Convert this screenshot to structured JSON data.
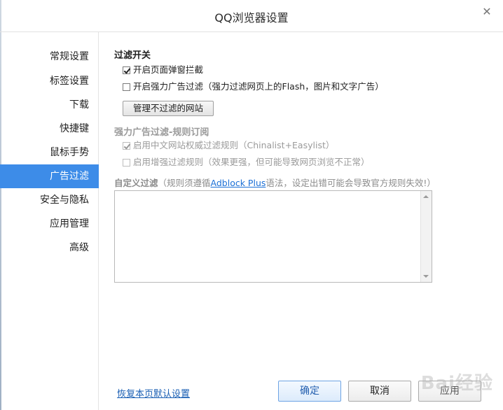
{
  "window": {
    "title": "QQ浏览器设置"
  },
  "sidebar": {
    "items": [
      {
        "label": "常规设置",
        "active": false
      },
      {
        "label": "标签设置",
        "active": false
      },
      {
        "label": "下载",
        "active": false
      },
      {
        "label": "快捷键",
        "active": false
      },
      {
        "label": "鼠标手势",
        "active": false
      },
      {
        "label": "广告过滤",
        "active": true
      },
      {
        "label": "安全与隐私",
        "active": false
      },
      {
        "label": "应用管理",
        "active": false
      },
      {
        "label": "高级",
        "active": false
      }
    ]
  },
  "filter_switch": {
    "title": "过滤开关",
    "popup_block": {
      "label": "开启页面弹窗拦截",
      "checked": true
    },
    "strong_filter": {
      "label": "开启强力广告过滤（强力过滤网页上的Flash，图片和文字广告）",
      "checked": false
    },
    "manage_button": "管理不过滤的网站"
  },
  "subscription": {
    "title": "强力广告过滤-规则订阅",
    "chinalist": {
      "label": "启用中文网站权威过滤规则（Chinalist+Easylist）",
      "checked": true
    },
    "enhanced": {
      "label": "启用增强过滤规则（效果更强，但可能导致网页浏览不正常）",
      "checked": false
    }
  },
  "custom": {
    "label_strong": "自定义过滤",
    "label_pre": "（规则须遵循",
    "link": "Adblock Plus",
    "label_post": "语法，设定出错可能会导致官方规则失效!）",
    "value": ""
  },
  "footer": {
    "restore": "恢复本页默认设置",
    "ok": "确定",
    "cancel": "取消",
    "apply": "应用"
  },
  "watermark": "Bai经验",
  "colors": {
    "active_nav": "#3d8ce8",
    "link": "#1a6fd6"
  }
}
